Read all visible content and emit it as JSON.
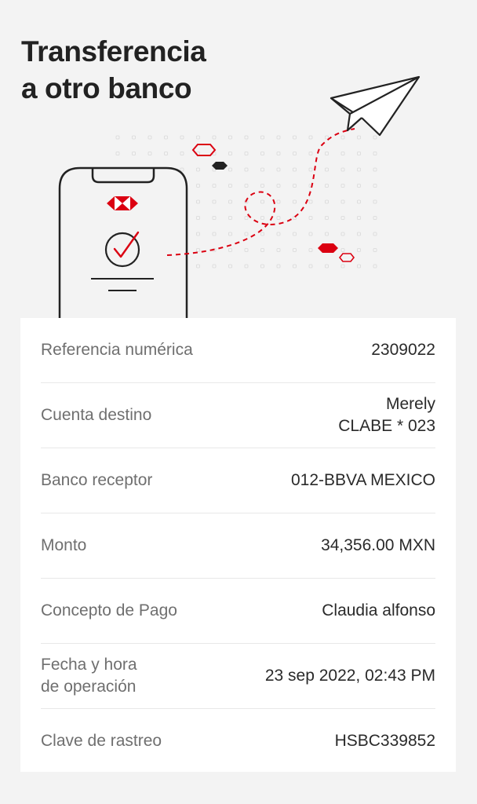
{
  "header": {
    "title_line1": "Transferencia",
    "title_line2": "a otro banco"
  },
  "colors": {
    "brand_red": "#db0011",
    "text_dark": "#222222",
    "text_label": "#6f6f6f",
    "background": "#f3f3f3",
    "card": "#ffffff"
  },
  "illustration": {
    "icons": [
      "phone-icon",
      "hsbc-logo-icon",
      "check-circle-icon",
      "paper-plane-icon"
    ]
  },
  "details": {
    "rows": [
      {
        "label": "Referencia numérica",
        "value": "2309022"
      },
      {
        "label": "Cuenta destino",
        "value": "Merely\nCLABE * 023"
      },
      {
        "label": "Banco receptor",
        "value": "012-BBVA MEXICO"
      },
      {
        "label": "Monto",
        "value": "34,356.00 MXN"
      },
      {
        "label": "Concepto de Pago",
        "value": "Claudia alfonso"
      },
      {
        "label": "Fecha y hora\nde operación",
        "value": "23 sep 2022, 02:43 PM"
      },
      {
        "label": "Clave de rastreo",
        "value": "HSBC339852"
      }
    ]
  }
}
